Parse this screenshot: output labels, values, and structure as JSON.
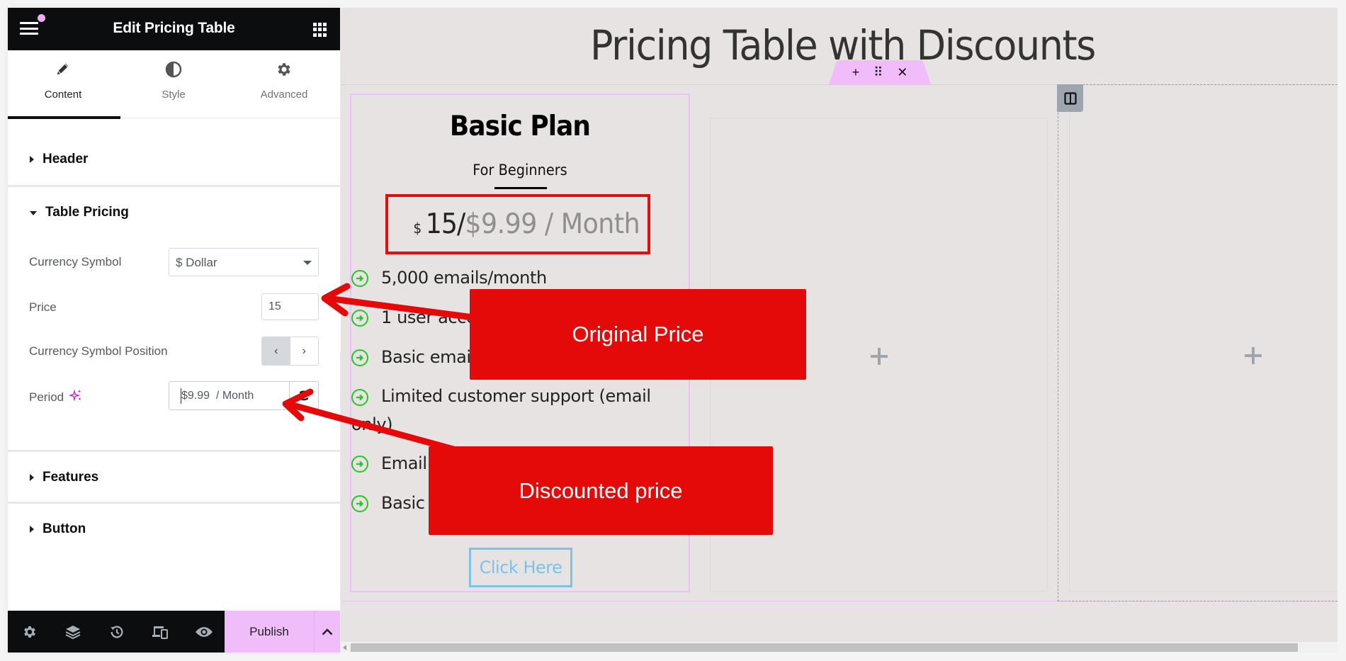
{
  "editor": {
    "title": "Edit Pricing Table",
    "tabs": [
      {
        "label": "Content",
        "icon": "pencil-icon",
        "active": true
      },
      {
        "label": "Style",
        "icon": "half-circle-icon",
        "active": false
      },
      {
        "label": "Advanced",
        "icon": "gear-icon",
        "active": false
      }
    ],
    "sections": {
      "header": "Header",
      "table_pricing": "Table Pricing",
      "features": "Features",
      "button": "Button"
    },
    "controls": {
      "currency_symbol": {
        "label": "Currency Symbol",
        "value": "$ Dollar"
      },
      "price": {
        "label": "Price",
        "value": "15"
      },
      "currency_symbol_position": {
        "label": "Currency Symbol Position",
        "options": [
          "‹",
          "›"
        ],
        "selected": 0
      },
      "period": {
        "label": "Period",
        "value": "$9.99  / Month"
      }
    },
    "footer": {
      "publish_label": "Publish",
      "icons": [
        "gear-icon",
        "layers-icon",
        "history-icon",
        "responsive-icon",
        "eye-icon"
      ]
    }
  },
  "canvas": {
    "page_title": "Pricing Table with Discounts",
    "widget_toolbar": {
      "add": "+",
      "drag": "⠿",
      "close": "✕"
    },
    "pricing_card": {
      "plan_name": "Basic Plan",
      "subtitle": "For Beginners",
      "currency": "$",
      "price": "15/",
      "period": "$9.99 / Month",
      "features": [
        "5,000 emails/month",
        "1 user acce",
        "Basic emai",
        "Limited customer support (email only)",
        "Email",
        "Basic"
      ],
      "button_label": "Click Here"
    }
  },
  "annotations": {
    "original_price": "Original Price",
    "discounted_price": "Discounted price",
    "color": "#e50a0a"
  },
  "colors": {
    "accent_pink": "#f0bdfa",
    "feature_icon_green": "#26c626",
    "button_blue": "#7cc3e6"
  }
}
